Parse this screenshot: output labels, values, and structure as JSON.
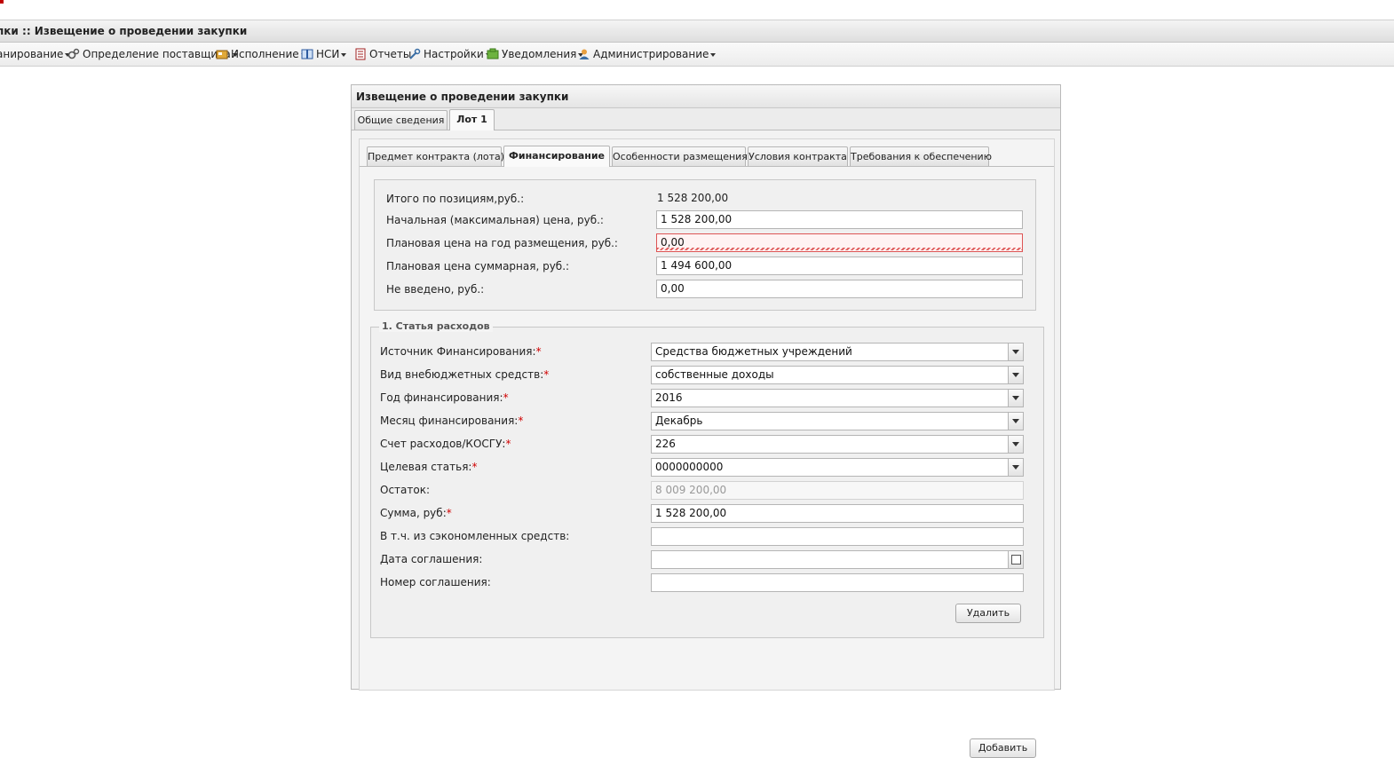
{
  "window": {
    "title": "пки :: Извещение о проведении закупки"
  },
  "menu": {
    "items": [
      {
        "label": "анирование",
        "icon": "planning-icon"
      },
      {
        "label": "Определение поставщика",
        "icon": "gears-icon"
      },
      {
        "label": "Исполнение",
        "icon": "execution-icon"
      },
      {
        "label": "НСИ",
        "icon": "book-icon"
      },
      {
        "label": "Отчеты",
        "icon": "report-icon"
      },
      {
        "label": "Настройки",
        "icon": "wrench-icon"
      },
      {
        "label": "Уведомления",
        "icon": "notification-icon"
      },
      {
        "label": "Администрирование",
        "icon": "user-icon"
      }
    ]
  },
  "panel": {
    "title": "Извещение о проведении закупки",
    "outer_tabs": [
      "Общие сведения",
      "Лот 1"
    ],
    "outer_active": "Лот 1",
    "inner_tabs": [
      "Предмет контракта (лота)",
      "Финансирование",
      "Особенности размещения",
      "Условия контракта",
      "Требования к обеспечению"
    ],
    "inner_active": "Финансирование"
  },
  "summary": {
    "total_label": "Итого по позициям,руб.:",
    "total_value": "1 528 200,00",
    "initial_price_label": "Начальная (максимальная) цена, руб.:",
    "initial_price_value": "1 528 200,00",
    "planned_year_label": "Плановая цена на год размещения, руб.:",
    "planned_year_value": "0,00",
    "planned_total_label": "Плановая цена суммарная, руб.:",
    "planned_total_value": "1 494 600,00",
    "not_entered_label": "Не введено, руб.:",
    "not_entered_value": "0,00"
  },
  "expense": {
    "legend": "1. Статья расходов",
    "source_label": "Источник Финансирования:",
    "source_value": "Средства бюджетных учреждений",
    "extra_label": "Вид внебюджетных средств:",
    "extra_value": "собственные доходы",
    "year_label": "Год финансирования:",
    "year_value": "2016",
    "month_label": "Месяц финансирования:",
    "month_value": "Декабрь",
    "account_label": "Счет расходов/КОСГУ:",
    "account_value": "226",
    "target_label": "Целевая статья:",
    "target_value": "0000000000",
    "balance_label": "Остаток:",
    "balance_value": "8 009 200,00",
    "sum_label": "Сумма, руб:",
    "sum_value": "1 528 200,00",
    "saved_label": "В т.ч. из сэкономленных средств:",
    "saved_value": "",
    "agreement_date_label": "Дата соглашения:",
    "agreement_date_value": "",
    "agreement_num_label": "Номер соглашения:",
    "agreement_num_value": "",
    "required_mark": "*",
    "delete_button": "Удалить"
  },
  "add_button": "Добавить",
  "colors": {
    "required": "#d00000",
    "invalid_border": "#d55555"
  }
}
